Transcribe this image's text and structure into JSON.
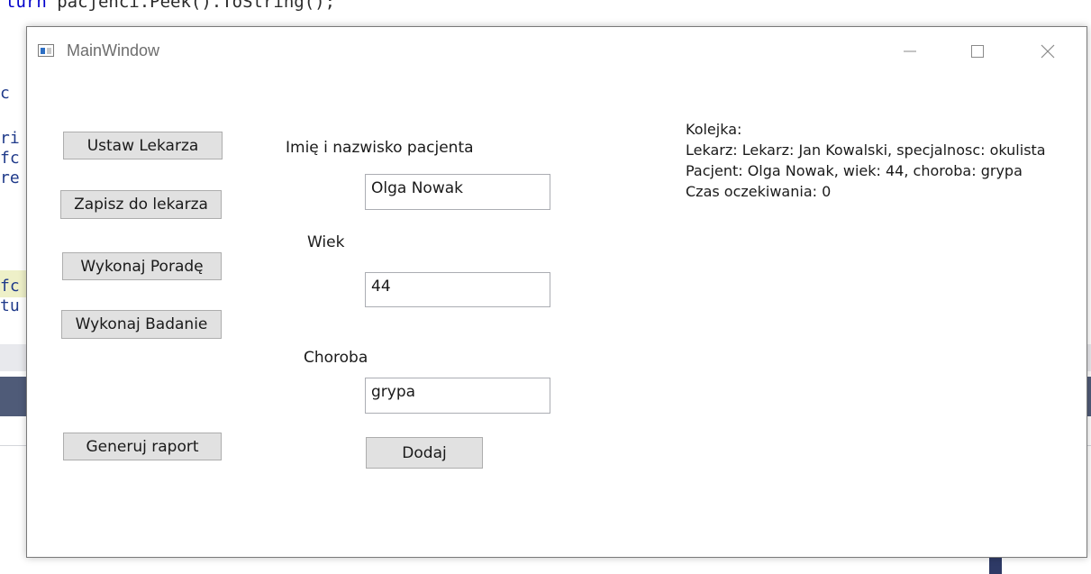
{
  "background": {
    "code_top_prefix": "turn ",
    "code_top_text": "pacjenci.Peek().ToString();",
    "fragments": [
      "c",
      "ri",
      "fc",
      "re",
      "fc",
      "tu"
    ]
  },
  "window": {
    "title": "MainWindow",
    "controls": {
      "minimize": "minimize-icon",
      "maximize": "maximize-icon",
      "close": "close-icon"
    }
  },
  "buttons": {
    "ustaw_lekarza": "Ustaw Lekarza",
    "zapisz_do_lekarza": "Zapisz do lekarza",
    "wykonaj_porade": "Wykonaj Poradę",
    "wykonaj_badanie": "Wykonaj Badanie",
    "generuj_raport": "Generuj raport",
    "dodaj": "Dodaj"
  },
  "form": {
    "name_label": "Imię i nazwisko pacjenta",
    "name_value": "Olga Nowak",
    "age_label": "Wiek",
    "age_value": "44",
    "disease_label": "Choroba",
    "disease_value": "grypa"
  },
  "info": {
    "lines": [
      "Kolejka:",
      "Lekarz: Lekarz: Jan Kowalski, specjalnosc: okulista",
      "Pacjent: Olga Nowak, wiek: 44, choroba: grypa",
      "Czas oczekiwania: 0"
    ]
  },
  "colors": {
    "button_face": "#e1e1e1",
    "button_border": "#adadad",
    "ide_band": "#4f5b78",
    "ide_keyword": "#0000cc"
  }
}
